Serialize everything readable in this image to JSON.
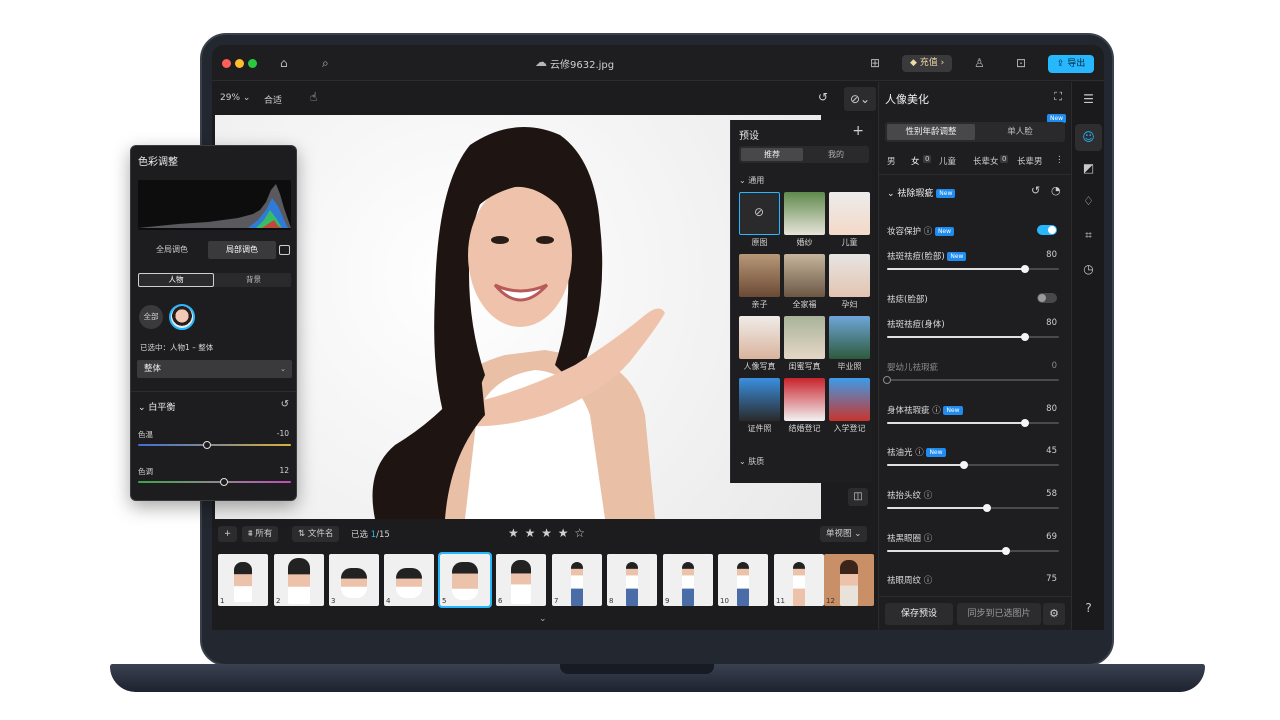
{
  "titlebar": {
    "filename": "云修9632.jpg",
    "recharge_label": "充值",
    "export_label": "导出"
  },
  "toolbar": {
    "zoom": "29%",
    "fit_label": "合适"
  },
  "presets": {
    "title": "预设",
    "tabs": [
      "推荐",
      "我的"
    ],
    "section_general": "通用",
    "section_skin": "肤质",
    "items": [
      {
        "label": "原图"
      },
      {
        "label": "婚纱"
      },
      {
        "label": "儿童"
      },
      {
        "label": "亲子"
      },
      {
        "label": "全家福"
      },
      {
        "label": "孕妇"
      },
      {
        "label": "人像写真"
      },
      {
        "label": "闺蜜写真"
      },
      {
        "label": "毕业照"
      },
      {
        "label": "证件照"
      },
      {
        "label": "结婚登记"
      },
      {
        "label": "入学登记"
      }
    ]
  },
  "filmstrip": {
    "filter_all": "所有",
    "sort_label": "文件名",
    "selected_prefix": "已选",
    "selected_count": "1",
    "total": "/15",
    "view_mode": "单视图",
    "rating_stars": "★ ★ ★ ★ ☆",
    "thumbs": [
      "1",
      "2",
      "3",
      "4",
      "5",
      "6",
      "7",
      "8",
      "9",
      "10",
      "11",
      "12"
    ]
  },
  "right_panel": {
    "title": "人像美化",
    "tab_a": "性别年龄调整",
    "tab_b": "单人脸",
    "new_badge": "New",
    "groups": [
      "男",
      "女",
      "0",
      "儿童",
      "长辈女",
      "0",
      "长辈男"
    ],
    "section_title": "祛除瑕疵",
    "makeup_protect": "妆容保护",
    "params": [
      {
        "label": "祛斑祛痘(脸部)",
        "value": 80,
        "new": true
      },
      {
        "label": "祛痣(脸部)",
        "toggle": false
      },
      {
        "label": "祛斑祛痘(身体)",
        "value": 80
      },
      {
        "label": "婴幼儿祛瑕疵",
        "value": 0,
        "dim": true
      },
      {
        "label": "身体祛瑕疵",
        "value": 80,
        "new": true
      },
      {
        "label": "祛油光",
        "value": 45,
        "new": true
      },
      {
        "label": "祛抬头纹",
        "value": 58
      },
      {
        "label": "祛黑眼圈",
        "value": 69
      },
      {
        "label": "祛眼周纹",
        "value": 75
      }
    ],
    "save_preset": "保存预设",
    "sync_label": "同步到已选图片"
  },
  "color_panel": {
    "title": "色彩调整",
    "tab_global": "全局调色",
    "tab_local": "局部调色",
    "sub_person": "人物",
    "sub_bg": "背景",
    "all_label": "全部",
    "selected_text": "已选中：人物1 – 整体",
    "dropdown_value": "整体",
    "wb_title": "白平衡",
    "temp_label": "色温",
    "temp_value": "-10",
    "tint_label": "色调",
    "tint_value": "12"
  },
  "colors": {
    "accent": "#27b7ff",
    "new_badge": "#1e8cf0"
  }
}
